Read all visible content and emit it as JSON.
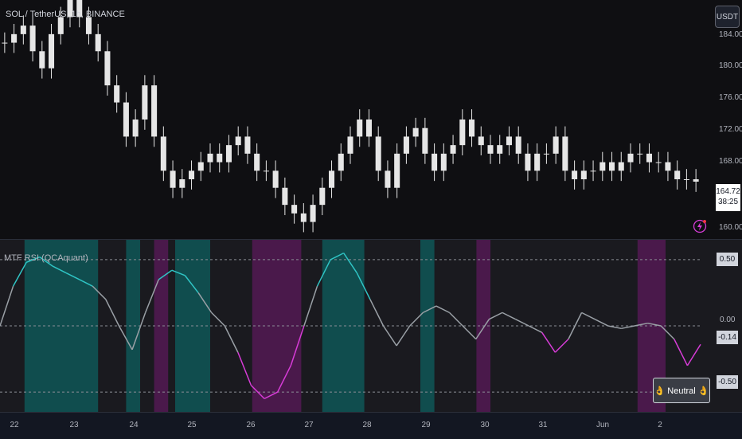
{
  "chart": {
    "symbol_title": "SOL / TetherUS, 1h, BINANCE",
    "currency_button": "USDT",
    "last_price": "164.72",
    "countdown": "38:25",
    "price_axis": [
      "184.00",
      "180.00",
      "176.00",
      "172.00",
      "168.00",
      "160.00"
    ]
  },
  "indicator": {
    "title": "MTF RSI (QCAquant)",
    "axis": [
      "0.50",
      "0.00",
      "-0.14",
      "-0.50"
    ],
    "badge": "👌 Neutral 👌"
  },
  "time_axis": [
    "22",
    "23",
    "24",
    "25",
    "26",
    "27",
    "28",
    "29",
    "30",
    "31",
    "Jun",
    "2"
  ],
  "colors": {
    "background": "#131722",
    "candle": "#e6e6e6",
    "rsi_bull": "#2fc4c4",
    "rsi_bear": "#d83cd8",
    "rsi_neutral": "#9aa0a6",
    "zone_bull": "#0d5f5f",
    "zone_bear": "#5b1a5b"
  },
  "chart_data": {
    "type": "line",
    "price_series": [
      181,
      182,
      183,
      180,
      178,
      182,
      184,
      186,
      184,
      182,
      180,
      176,
      174,
      170,
      172,
      176,
      170,
      166,
      164,
      165,
      166,
      167,
      168,
      167,
      169,
      170,
      168,
      166,
      166,
      164,
      162,
      161,
      160,
      162,
      164,
      166,
      168,
      170,
      172,
      170,
      166,
      164,
      168,
      170,
      171,
      168,
      166,
      168,
      169,
      172,
      170,
      169,
      168,
      169,
      170,
      168,
      166,
      168,
      168,
      170,
      166,
      165,
      166,
      166,
      167,
      166,
      167,
      168,
      168,
      167,
      167,
      166,
      165,
      165,
      164.72
    ],
    "rsi_series": [
      0.0,
      0.3,
      0.48,
      0.52,
      0.45,
      0.4,
      0.35,
      0.3,
      0.2,
      0.0,
      -0.18,
      0.1,
      0.35,
      0.42,
      0.38,
      0.25,
      0.1,
      0.0,
      -0.2,
      -0.45,
      -0.55,
      -0.5,
      -0.3,
      0.0,
      0.3,
      0.5,
      0.55,
      0.4,
      0.2,
      0.0,
      -0.15,
      0.0,
      0.1,
      0.15,
      0.1,
      0.0,
      -0.1,
      0.05,
      0.1,
      0.05,
      0.0,
      -0.05,
      -0.2,
      -0.1,
      0.1,
      0.05,
      0.0,
      -0.02,
      0.0,
      0.02,
      0.0,
      -0.1,
      -0.3,
      -0.14
    ],
    "price_ylim": [
      158,
      186
    ],
    "rsi_ylim": [
      -0.65,
      0.65
    ],
    "zones": [
      {
        "from": 0.035,
        "to": 0.14,
        "kind": "bull"
      },
      {
        "from": 0.18,
        "to": 0.2,
        "kind": "bull"
      },
      {
        "from": 0.22,
        "to": 0.24,
        "kind": "bear"
      },
      {
        "from": 0.25,
        "to": 0.3,
        "kind": "bull"
      },
      {
        "from": 0.36,
        "to": 0.43,
        "kind": "bear"
      },
      {
        "from": 0.46,
        "to": 0.52,
        "kind": "bull"
      },
      {
        "from": 0.6,
        "to": 0.62,
        "kind": "bull"
      },
      {
        "from": 0.68,
        "to": 0.7,
        "kind": "bear"
      },
      {
        "from": 0.91,
        "to": 0.95,
        "kind": "bear"
      }
    ]
  }
}
